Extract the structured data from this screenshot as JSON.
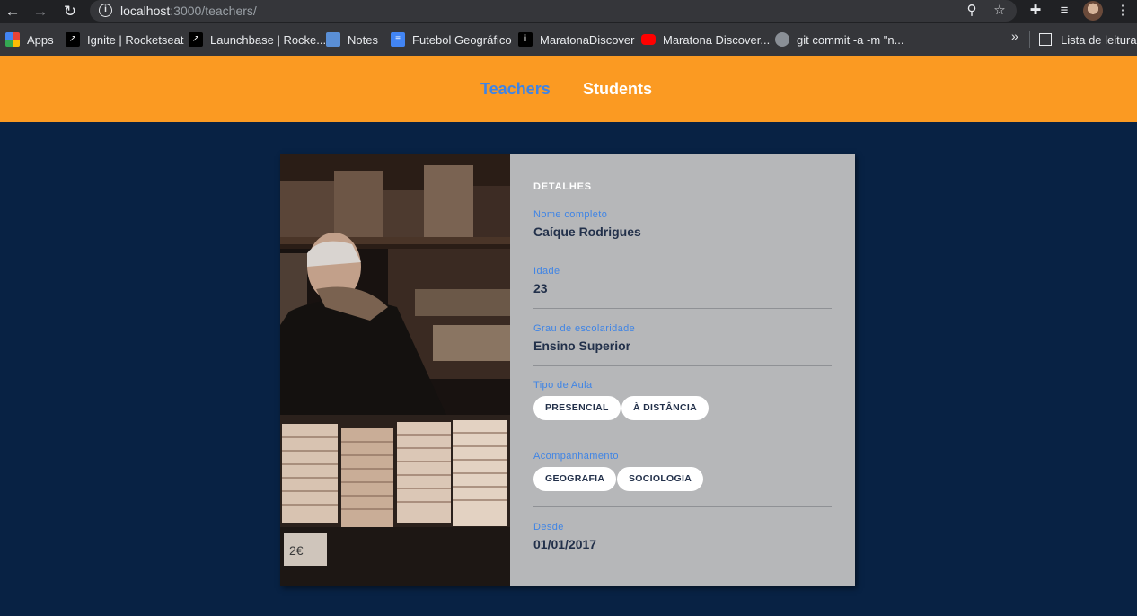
{
  "browser": {
    "url_host": "localhost",
    "url_path": ":3000/teachers/",
    "bookmarks": [
      {
        "label": "Apps",
        "icon": "apps-grid-icon"
      },
      {
        "label": "Ignite | Rocketseat",
        "icon": "rocketseat-icon"
      },
      {
        "label": "Launchbase | Rocke...",
        "icon": "rocketseat-icon"
      },
      {
        "label": "Notes",
        "icon": "laptop-icon"
      },
      {
        "label": "Futebol Geográfico",
        "icon": "google-docs-icon"
      },
      {
        "label": "MaratonaDiscover",
        "icon": "maratona-icon"
      },
      {
        "label": "Maratona Discover...",
        "icon": "youtube-icon"
      },
      {
        "label": "git commit -a -m \"n...",
        "icon": "git-icon"
      }
    ],
    "more_bookmarks": "»",
    "reading_list": "Lista de leitura"
  },
  "header": {
    "nav": [
      {
        "label": "Teachers",
        "active": true
      },
      {
        "label": "Students",
        "active": false
      }
    ],
    "colors": {
      "background": "#fb9a22",
      "active": "#3f84e5",
      "inactive": "#ffffff"
    }
  },
  "teacher": {
    "section_title": "DETALHES",
    "fields": [
      {
        "label": "Nome completo",
        "value": "Caíque Rodrigues"
      },
      {
        "label": "Idade",
        "value": "23"
      },
      {
        "label": "Grau de escolaridade",
        "value": "Ensino Superior"
      },
      {
        "label": "Tipo de Aula",
        "tags": [
          "PRESENCIAL",
          "À DISTÂNCIA"
        ]
      },
      {
        "label": "Acompanhamento",
        "tags": [
          "GEOGRAFIA",
          "SOCIOLOGIA"
        ]
      },
      {
        "label": "Desde",
        "value": "01/01/2017"
      }
    ],
    "photo_price_tag": "2€"
  },
  "colors": {
    "page_background": "#082244",
    "card_background": "#b6b7b9",
    "label": "#3f84e5",
    "value": "#22304a"
  }
}
